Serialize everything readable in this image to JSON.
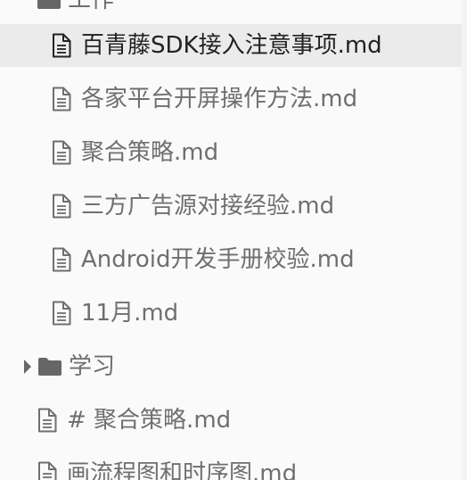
{
  "tree": {
    "items": [
      {
        "label": "工作",
        "type": "folder",
        "expanded": true
      },
      {
        "label": "百青藤SDK接入注意事项.md",
        "type": "file",
        "selected": true
      },
      {
        "label": "各家平台开屏操作方法.md",
        "type": "file"
      },
      {
        "label": "聚合策略.md",
        "type": "file"
      },
      {
        "label": "三方广告源对接经验.md",
        "type": "file"
      },
      {
        "label": "Android开发手册校验.md",
        "type": "file"
      },
      {
        "label": "11月.md",
        "type": "file"
      },
      {
        "label": "学习",
        "type": "folder",
        "expanded": false
      },
      {
        "label": "# 聚合策略.md",
        "type": "file"
      },
      {
        "label": "画流程图和时序图.md",
        "type": "file"
      }
    ]
  },
  "colors": {
    "background": "#fafafa",
    "selected_background": "#ebebeb",
    "text": "#6f6f6f",
    "selected_text": "#222222",
    "folder_icon": "#666666"
  },
  "icons": {
    "file": "document-icon",
    "folder": "folder-icon",
    "collapsed": "caret-right-icon"
  }
}
